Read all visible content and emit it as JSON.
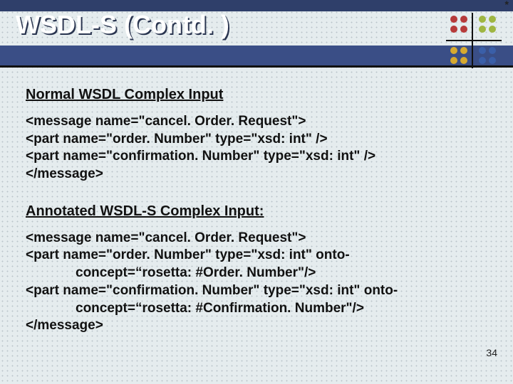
{
  "header": {
    "title": "WSDL-S (Contd. )",
    "asterisk": "*"
  },
  "decor": {
    "colors": {
      "tl": "#b63a3a",
      "tr": "#9fb642",
      "bl": "#d6a92f",
      "br": "#3a5fa8"
    }
  },
  "section1": {
    "heading": "Normal WSDL Complex Input",
    "lines": [
      "<message name=\"cancel. Order. Request\">",
      "<part name=\"order. Number\" type=\"xsd: int\" />",
      "<part name=\"confirmation. Number\" type=\"xsd: int\"  />",
      "</message>"
    ]
  },
  "section2": {
    "heading": "Annotated WSDL-S Complex Input:",
    "lines": [
      {
        "main": "<message name=\"cancel. Order. Request\">"
      },
      {
        "main": "<part name=\"order. Number\" type=\"xsd: int\"  onto-",
        "cont": "concept=“rosetta: #Order. Number\"/>"
      },
      {
        "main": "<part name=\"confirmation. Number\" type=\"xsd: int\"  onto-",
        "cont": "concept=“rosetta: #Confirmation. Number\"/>"
      },
      {
        "main": "</message>"
      }
    ]
  },
  "pagenum": "34"
}
